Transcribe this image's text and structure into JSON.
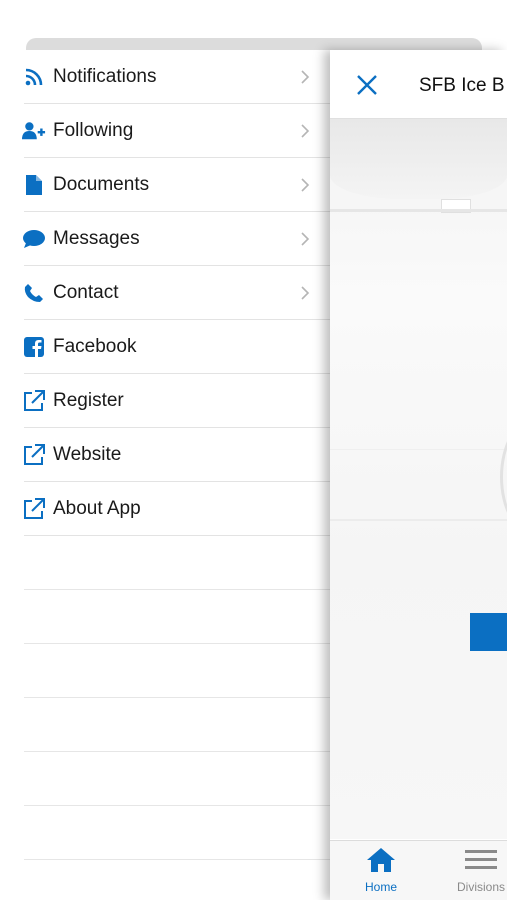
{
  "menu": {
    "items": [
      {
        "label": "Notifications",
        "icon": "rss-icon",
        "chevron": true
      },
      {
        "label": "Following",
        "icon": "user-plus-icon",
        "chevron": true
      },
      {
        "label": "Documents",
        "icon": "document-icon",
        "chevron": true
      },
      {
        "label": "Messages",
        "icon": "chat-bubble-icon",
        "chevron": true
      },
      {
        "label": "Contact",
        "icon": "phone-icon",
        "chevron": true
      },
      {
        "label": "Facebook",
        "icon": "facebook-icon",
        "chevron": false
      },
      {
        "label": "Register",
        "icon": "external-link-icon",
        "chevron": false
      },
      {
        "label": "Website",
        "icon": "external-link-icon",
        "chevron": false
      },
      {
        "label": "About App",
        "icon": "external-link-icon",
        "chevron": false
      }
    ]
  },
  "header": {
    "title": "SFB Ice B"
  },
  "tabs": {
    "home_label": "Home",
    "divisions_label": "Divisions"
  },
  "colors": {
    "accent": "#0B6FC2",
    "text": "#1A1A1A",
    "inactive_tab": "#8A8A8A"
  }
}
